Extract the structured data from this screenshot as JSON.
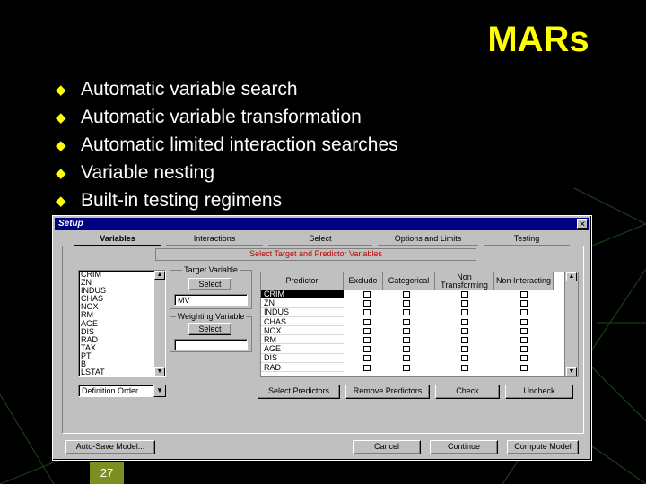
{
  "slide": {
    "title": "MARs",
    "bullets": [
      "Automatic variable search",
      "Automatic variable transformation",
      "Automatic limited interaction searches",
      "Variable nesting",
      "Built-in testing regimens"
    ],
    "page_number": "27",
    "colors": {
      "background": "#000000",
      "title": "#ffff00",
      "text": "#ffffff",
      "bullet": "#ffff00",
      "page_box": "#7a8f1f"
    }
  },
  "dialog": {
    "title": "Setup",
    "close_label": "✕",
    "tabs": [
      "Variables",
      "Interactions",
      "Select",
      "Options and Limits",
      "Testing"
    ],
    "active_tab": "Variables",
    "heading": "Select Target and Predictor Variables",
    "variables": [
      "CRIM",
      "ZN",
      "INDUS",
      "CHAS",
      "NOX",
      "RM",
      "AGE",
      "DIS",
      "RAD",
      "TAX",
      "PT",
      "B",
      "LSTAT"
    ],
    "target_group": {
      "label": "Target Variable",
      "button": "Select",
      "value": "MV"
    },
    "weighting_group": {
      "label": "Weighting Variable",
      "button": "Select",
      "value": ""
    },
    "sort_dropdown": {
      "value": "Definition Order",
      "arrow": "▼"
    },
    "grid": {
      "columns": [
        "Predictor",
        "Exclude",
        "Categorical",
        "Non Transforming",
        "Non Interacting"
      ],
      "rows": [
        "CRIM",
        "ZN",
        "INDUS",
        "CHAS",
        "NOX",
        "RM",
        "AGE",
        "DIS",
        "RAD"
      ],
      "selected_row": "CRIM"
    },
    "buttons": {
      "select_predictors": "Select Predictors",
      "remove_predictors": "Remove Predictors",
      "check": "Check",
      "uncheck": "Uncheck",
      "auto_save": "Auto-Save Model...",
      "cancel": "Cancel",
      "continue": "Continue",
      "compute": "Compute Model"
    },
    "colors": {
      "face": "#c0c0c0",
      "titlebar": "#000080",
      "heading_text": "#c00000"
    }
  }
}
